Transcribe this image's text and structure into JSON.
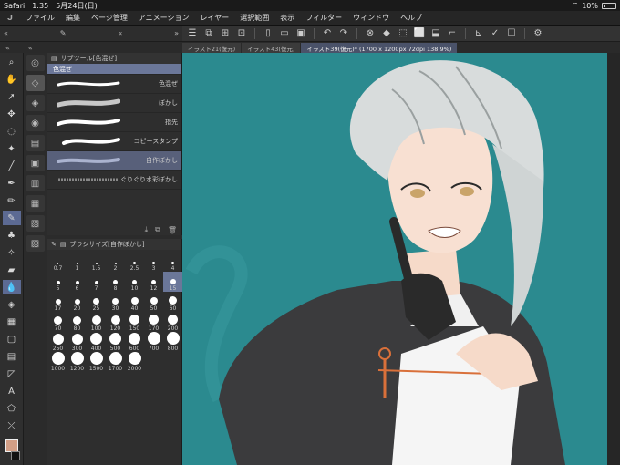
{
  "status": {
    "carrier": "Safari",
    "time": "1:35",
    "date": "5月24日(日)",
    "battery": "10%"
  },
  "menu": [
    "ファイル",
    "編集",
    "ページ管理",
    "アニメーション",
    "レイヤー",
    "選択範囲",
    "表示",
    "フィルター",
    "ウィンドウ",
    "ヘルプ"
  ],
  "tabs": [
    {
      "label": "イラスト21(復元)"
    },
    {
      "label": "イラスト43(復元)"
    },
    {
      "label": "イラスト39(復元)* (1700 x 1200px 72dpi 138.9%)"
    }
  ],
  "subtool": {
    "title": "サブツール[色混ぜ]",
    "group": "色混ぜ",
    "brushes": [
      {
        "label": "色混ぜ"
      },
      {
        "label": "ぼかし"
      },
      {
        "label": "指先"
      },
      {
        "label": "コピースタンプ"
      },
      {
        "label": "自作ぼかし"
      },
      {
        "label": "ぐりぐり水彩ぼかし"
      }
    ]
  },
  "brushsize": {
    "title": "ブラシサイズ[自作ぼかし]",
    "sizes": [
      "0.7",
      "1",
      "1.5",
      "2",
      "2.5",
      "3",
      "4",
      "5",
      "6",
      "7",
      "8",
      "10",
      "12",
      "15",
      "17",
      "20",
      "25",
      "30",
      "40",
      "50",
      "60",
      "70",
      "80",
      "100",
      "120",
      "150",
      "170",
      "200",
      "250",
      "300",
      "400",
      "500",
      "600",
      "700",
      "800",
      "1000",
      "1200",
      "1500",
      "1700",
      "2000"
    ],
    "selected": "15"
  },
  "colors": {
    "main": "#d29f86",
    "sub": "#111111",
    "canvas_bg": "#2b8a8f",
    "accent": "#5c6a93"
  }
}
